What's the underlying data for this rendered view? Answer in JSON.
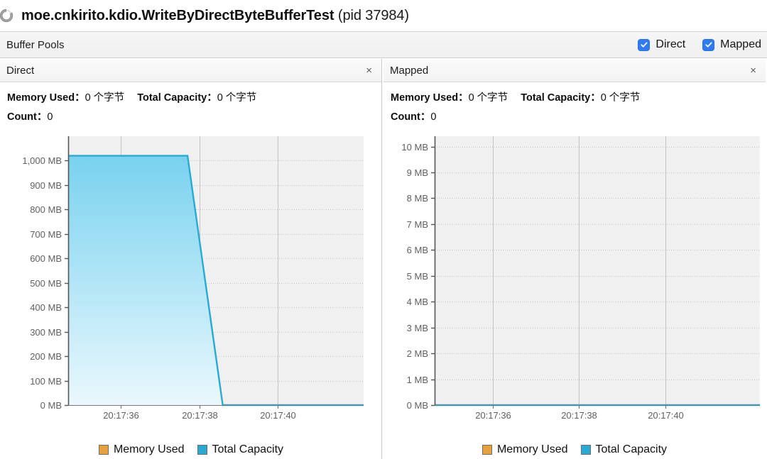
{
  "window": {
    "spinner_icon": "loading-spinner-icon",
    "title_main": "moe.cnkirito.kdio.WriteByDirectByteBufferTest",
    "title_pid": "(pid 37984)"
  },
  "toolbar": {
    "title": "Buffer Pools",
    "checkboxes": [
      {
        "label": "Direct",
        "checked": true,
        "icon": "checkmark-icon"
      },
      {
        "label": "Mapped",
        "checked": true,
        "icon": "checkmark-icon"
      }
    ],
    "accent_color": "#2f7bf6"
  },
  "panels": [
    {
      "key": "direct",
      "header_title": "Direct",
      "close_icon": "close-icon",
      "close_label": "×",
      "stats": {
        "memory_used_label": "Memory Used：",
        "memory_used_value": "0 个字节",
        "total_capacity_label": "Total Capacity：",
        "total_capacity_value": "0 个字节",
        "count_label": "Count：",
        "count_value": "0"
      },
      "legend": [
        {
          "label": "Memory Used",
          "color": "#e8a23c"
        },
        {
          "label": "Total Capacity",
          "color": "#29aad4"
        }
      ]
    },
    {
      "key": "mapped",
      "header_title": "Mapped",
      "close_icon": "close-icon",
      "close_label": "×",
      "stats": {
        "memory_used_label": "Memory Used：",
        "memory_used_value": "0 个字节",
        "total_capacity_label": "Total Capacity：",
        "total_capacity_value": "0 个字节",
        "count_label": "Count：",
        "count_value": "0"
      },
      "legend": [
        {
          "label": "Memory Used",
          "color": "#e8a23c"
        },
        {
          "label": "Total Capacity",
          "color": "#29aad4"
        }
      ]
    }
  ],
  "chart_data": [
    {
      "id": "direct-buffer-pool-chart",
      "type": "area",
      "title": "Direct",
      "xlabel": "",
      "ylabel": "",
      "grid": true,
      "legend_position": "bottom",
      "ytick_labels": [
        "0 MB",
        "100 MB",
        "200 MB",
        "300 MB",
        "400 MB",
        "500 MB",
        "600 MB",
        "700 MB",
        "800 MB",
        "900 MB",
        "1,000 MB"
      ],
      "ytick_values": [
        0,
        100,
        200,
        300,
        400,
        500,
        600,
        700,
        800,
        900,
        1000
      ],
      "ylim": [
        0,
        1100
      ],
      "xtick_labels": [
        "20:17:36",
        "20:17:38",
        "20:17:40"
      ],
      "xtick_values": [
        36,
        38,
        40
      ],
      "xlim": [
        34.65,
        42.2
      ],
      "series": [
        {
          "name": "Total Capacity",
          "color": "#29aad4",
          "fill": true,
          "x": [
            34.65,
            37.7,
            38.6,
            42.2
          ],
          "values": [
            1020,
            1020,
            0,
            0
          ]
        },
        {
          "name": "Memory Used",
          "color": "#e8a23c",
          "fill": false,
          "x": [],
          "values": []
        }
      ]
    },
    {
      "id": "mapped-buffer-pool-chart",
      "type": "area",
      "title": "Mapped",
      "xlabel": "",
      "ylabel": "",
      "grid": true,
      "legend_position": "bottom",
      "ytick_labels": [
        "0 MB",
        "1 MB",
        "2 MB",
        "3 MB",
        "4 MB",
        "5 MB",
        "6 MB",
        "7 MB",
        "8 MB",
        "9 MB",
        "10 MB"
      ],
      "ytick_values": [
        0,
        1,
        2,
        3,
        4,
        5,
        6,
        7,
        8,
        9,
        10
      ],
      "ylim": [
        0,
        10.4
      ],
      "xtick_labels": [
        "20:17:36",
        "20:17:38",
        "20:17:40"
      ],
      "xtick_values": [
        36,
        38,
        40
      ],
      "xlim": [
        34.65,
        42.2
      ],
      "series": [
        {
          "name": "Total Capacity",
          "color": "#29aad4",
          "fill": true,
          "x": [
            34.65,
            42.2
          ],
          "values": [
            0,
            0
          ]
        },
        {
          "name": "Memory Used",
          "color": "#e8a23c",
          "fill": false,
          "x": [],
          "values": []
        }
      ]
    }
  ]
}
